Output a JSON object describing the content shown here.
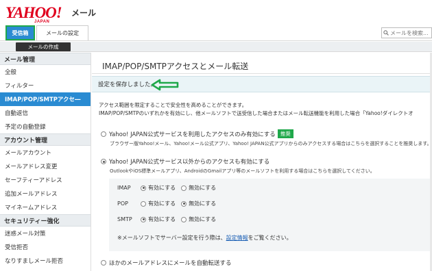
{
  "header": {
    "logo_main": "YAHOO!",
    "logo_sub": "JAPAN",
    "service": "メール",
    "tabs": {
      "inbox": "受信箱",
      "settings": "メールの設定"
    },
    "search": {
      "placeholder": "メールを検索..."
    }
  },
  "compose": {
    "label": "メールの作成"
  },
  "sidebar": {
    "sections": [
      {
        "title": "メール管理",
        "items": [
          "全般",
          "フィルター",
          "IMAP/POP/SMTPアクセ―",
          "自動返信",
          "予定の自動登録"
        ]
      },
      {
        "title": "アカウント管理",
        "items": [
          "メールアカウント",
          "メールアドレス変更",
          "セーフティーアドレス",
          "追加メールアドレス",
          "マイネームアドレス"
        ]
      },
      {
        "title": "セキュリティー強化",
        "items": [
          "迷惑メール対策",
          "受信拒否",
          "なりすましメール拒否"
        ]
      }
    ],
    "active_item": "IMAP/POP/SMTPアクセ―"
  },
  "main": {
    "title": "IMAP/POP/SMTPアクセスとメール転送",
    "notice": "設定を保存しました。",
    "description_1": "アクセス範囲を限定することで安全性を高めることができます。",
    "description_2": "IMAP/POP/SMTPのいずれかを有効にし、他メールソフトで送受信した場合またはメール転送機能を利用した場合「Yahoo!ダイレクトオ",
    "option_1": {
      "label": "Yahoo! JAPAN公式サービスを利用したアクセスのみ有効にする",
      "badge": "推奨",
      "note": "ブラウザー版Yahoo!メール、Yahoo!メール公式アプリ、Yahoo! JAPAN公式アプリからのみアクセスする場合はこちらを選択することを推奨します。",
      "checked": false
    },
    "option_2": {
      "label": "Yahoo! JAPAN公式サービス以外からのアクセスも有効にする",
      "note": "OutlookやiOS標準メールアプリ、AndroidのGmailアプリ等のメールソフトを利用する場合はこちらを選択してください。",
      "checked": true
    },
    "protocols": [
      {
        "name": "IMAP",
        "enable": "有効にする",
        "disable": "無効にする",
        "enabled": true
      },
      {
        "name": "POP",
        "enable": "有効にする",
        "disable": "無効にする",
        "enabled": false
      },
      {
        "name": "SMTP",
        "enable": "有効にする",
        "disable": "無効にする",
        "enabled": true
      }
    ],
    "proto_note_prefix": "※メールソフトでサーバー設定を行う際は、",
    "proto_note_link": "設定情報",
    "proto_note_suffix": "をご覧ください。",
    "option_3": {
      "label": "ほかのメールアドレスにメールを自動転送する",
      "checked": false
    }
  },
  "colors": {
    "brand_red": "#e0001e",
    "accent_blue": "#2a8bd2",
    "highlight_green": "#1fa84a",
    "notice_bg": "#eaf4f7"
  }
}
